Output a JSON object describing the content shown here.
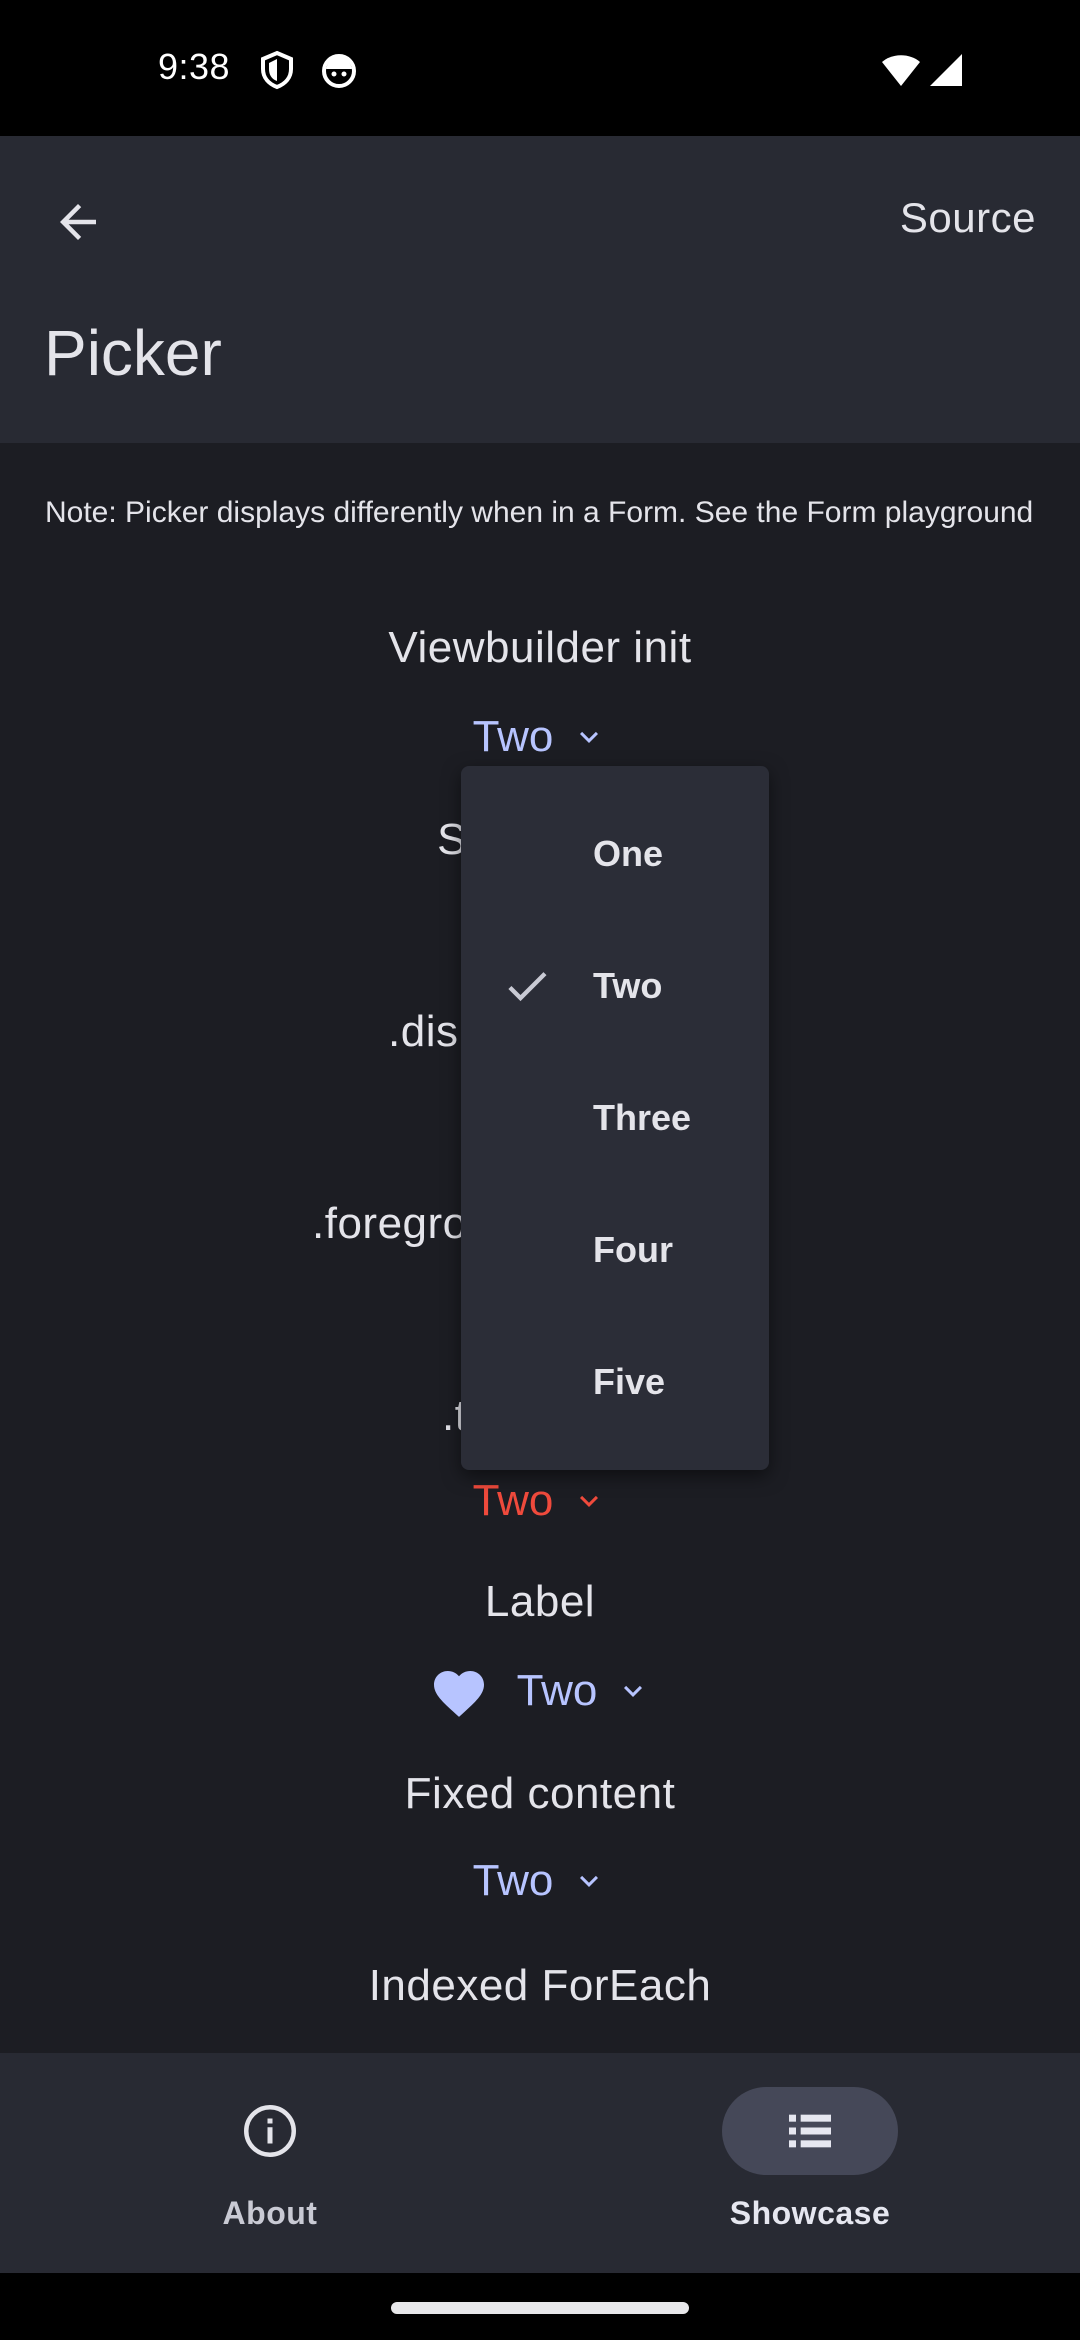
{
  "status_bar": {
    "time": "9:38",
    "icons": [
      "shield-icon",
      "android-face-icon",
      "wifi-icon",
      "signal-icon"
    ]
  },
  "app_bar": {
    "back_icon": "arrow-left-icon",
    "title": "Picker",
    "action_label": "Source"
  },
  "content": {
    "note": "Note: Picker displays differently when in a Form. See the Form playground",
    "sections": [
      {
        "label": "Viewbuilder init",
        "value": "Two"
      },
      {
        "label": "S",
        "value": ""
      },
      {
        "label": ".dis",
        "value": ""
      },
      {
        "label": ".foregro",
        "value": ""
      },
      {
        "label": ".t",
        "value": "Two"
      },
      {
        "label": "Label",
        "value": "Two"
      },
      {
        "label": "Fixed content",
        "value": "Two"
      },
      {
        "label": "Indexed ForEach",
        "value": ""
      }
    ]
  },
  "menu": {
    "items": [
      "One",
      "Two",
      "Three",
      "Four",
      "Five"
    ],
    "selected": "Two"
  },
  "bottom_nav": {
    "items": [
      {
        "label": "About",
        "icon": "info-icon",
        "active": false
      },
      {
        "label": "Showcase",
        "icon": "list-icon",
        "active": true
      }
    ]
  },
  "colors": {
    "accent": "#b7c4ff",
    "tint_red": "#ef4a3c",
    "background": "#1c1d23",
    "surface": "#282a33"
  }
}
